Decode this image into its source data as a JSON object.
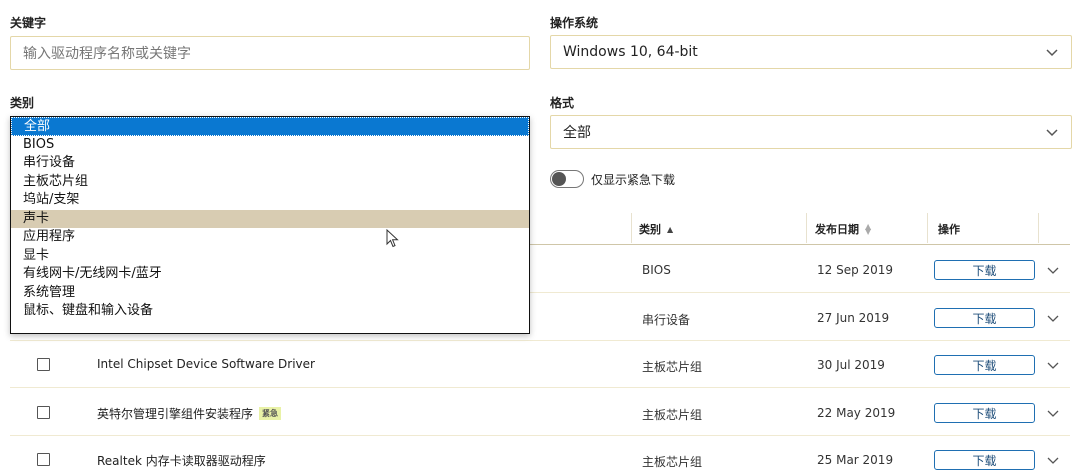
{
  "filters": {
    "keyword_label": "关键字",
    "keyword_placeholder": "输入驱动程序名称或关键字",
    "os_label": "操作系统",
    "os_value": "Windows 10, 64-bit",
    "category_label": "类别",
    "format_label": "格式",
    "format_value": "全部",
    "urgent_toggle_label": "仅显示紧急下载"
  },
  "category_dropdown": {
    "options": [
      "全部",
      "BIOS",
      "串行设备",
      "主板芯片组",
      "坞站/支架",
      "声卡",
      "应用程序",
      "显卡",
      "有线网卡/无线网卡/蓝牙",
      "系统管理",
      "鼠标、键盘和输入设备"
    ],
    "selected": "全部",
    "hovered": "声卡"
  },
  "table": {
    "headers": {
      "category": "类别",
      "date": "发布日期",
      "action": "操作"
    },
    "rows": [
      {
        "name": "",
        "badge": "",
        "category": "BIOS",
        "date": "12 Sep 2019",
        "action": "下载"
      },
      {
        "name": "",
        "badge": "",
        "category": "串行设备",
        "date": "27 Jun 2019",
        "action": "下载"
      },
      {
        "name": "Intel Chipset Device Software Driver",
        "badge": "",
        "category": "主板芯片组",
        "date": "30 Jul 2019",
        "action": "下载"
      },
      {
        "name": "英特尔管理引擎组件安装程序",
        "badge": "紧急",
        "category": "主板芯片组",
        "date": "22 May 2019",
        "action": "下载"
      },
      {
        "name": "Realtek 内存卡读取器驱动程序",
        "badge": "",
        "category": "主板芯片组",
        "date": "25 Mar 2019",
        "action": "下载"
      }
    ]
  },
  "colors": {
    "accent": "#0a78d1",
    "field_border": "#e4d7a8",
    "button_border": "#1f6fb2"
  }
}
